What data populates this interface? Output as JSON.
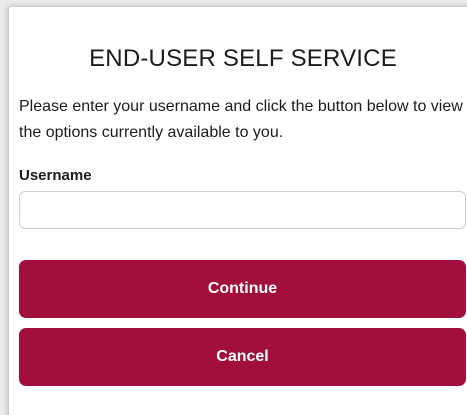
{
  "panel": {
    "title": "END-USER SELF SERVICE",
    "description": "Please enter your username and click the button below to view the options currently available to you."
  },
  "form": {
    "username_label": "Username",
    "username_value": "",
    "username_placeholder": ""
  },
  "buttons": {
    "continue_label": "Continue",
    "cancel_label": "Cancel"
  },
  "colors": {
    "primary_button": "#a20f3c",
    "button_text": "#ffffff",
    "text": "#1c1c1c"
  }
}
